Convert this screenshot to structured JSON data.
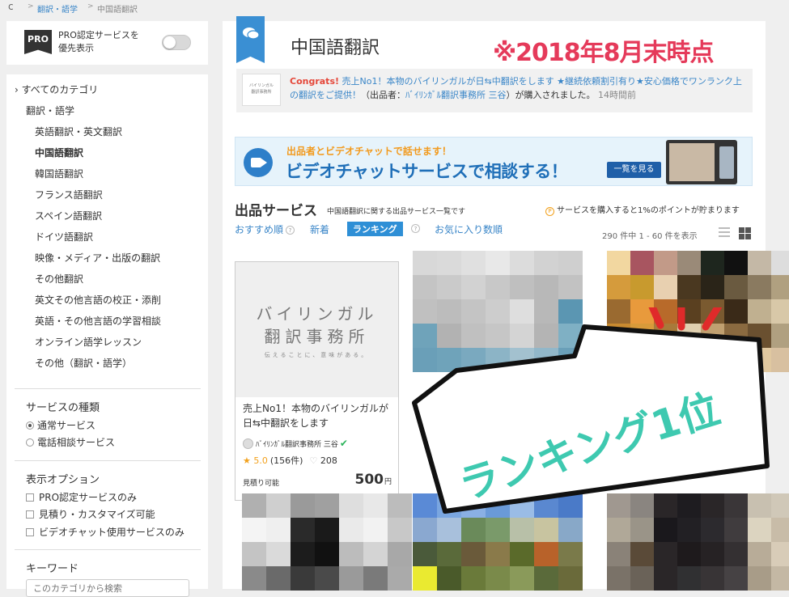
{
  "breadcrumb": {
    "home_icon": "c",
    "items": [
      "翻訳・語学",
      "中国語翻訳"
    ]
  },
  "pro_filter": {
    "icon_text": "PRO",
    "label_line1": "PRO認定サービスを",
    "label_line2": "優先表示"
  },
  "categories": {
    "all": "すべてのカテゴリ",
    "parent": "翻訳・語学",
    "items": [
      "英語翻訳・英文翻訳",
      "中国語翻訳",
      "韓国語翻訳",
      "フランス語翻訳",
      "スペイン語翻訳",
      "ドイツ語翻訳",
      "映像・メディア・出版の翻訳",
      "その他翻訳",
      "英文その他言語の校正・添削",
      "英語・その他言語の学習相談",
      "オンライン語学レッスン",
      "その他（翻訳・語学）"
    ],
    "active_index": 1
  },
  "service_type": {
    "heading": "サービスの種類",
    "options": [
      "通常サービス",
      "電話相談サービス"
    ]
  },
  "display_options": {
    "heading": "表示オプション",
    "options": [
      "PRO認定サービスのみ",
      "見積り・カスタマイズ可能",
      "ビデオチャット使用サービスのみ"
    ]
  },
  "keyword": {
    "heading": "キーワード",
    "placeholder": "このカテゴリから検索"
  },
  "header": {
    "title": "中国語翻訳",
    "annotation": "※2018年8月末時点"
  },
  "congrats": {
    "logo_line1": "バイリンガル",
    "logo_line2": "翻訳事務所",
    "label": "Congrats!",
    "service": "売上No1！本物のバイリンガルが日⇆中翻訳をします ★継続依頼割引有り★安心価格でワンランク上の翻訳をご提供！",
    "seller_prefix": "（出品者：",
    "seller": "ﾊﾞｲﾘﾝｶﾞﾙ翻訳事務所 三谷",
    "suffix": "）が購入されました。",
    "time": "14時間前"
  },
  "video_banner": {
    "subtitle": "出品者とビデオチャットで話せます！",
    "title": "ビデオチャットサービスで相談する！",
    "button": "一覧を見る"
  },
  "listing": {
    "heading": "出品サービス",
    "subheading": "中国語翻訳に関する出品サービス一覧です",
    "points_icon": "P",
    "points_note": "サービスを購入すると1%のポイントが貯まります",
    "sort": [
      "おすすめ順",
      "新着",
      "ランキング",
      "お気に入り数順"
    ],
    "count": "290 件中 1 - 60 件を表示"
  },
  "card": {
    "img_line1": "バイリンガル",
    "img_line2": "翻訳事務所",
    "img_tagline": "伝えることに、意味がある。",
    "title": "売上No1！本物のバイリンガルが日⇆中翻訳をします",
    "seller": "ﾊﾞｲﾘﾝｶﾞﾙ翻訳事務所 三谷",
    "star": "★",
    "score": "5.0",
    "reviews": "(156件)",
    "heart": "♡",
    "favorites": "208",
    "estimate": "見積り可能",
    "price": "500",
    "price_unit": "円"
  },
  "callout": {
    "text": "ランキング1位",
    "color": "#3ec9b0"
  },
  "colors": {
    "accent": "#3a86c8",
    "brand_ribbon": "#3a8fd3",
    "annotation": "#e53a5a"
  }
}
